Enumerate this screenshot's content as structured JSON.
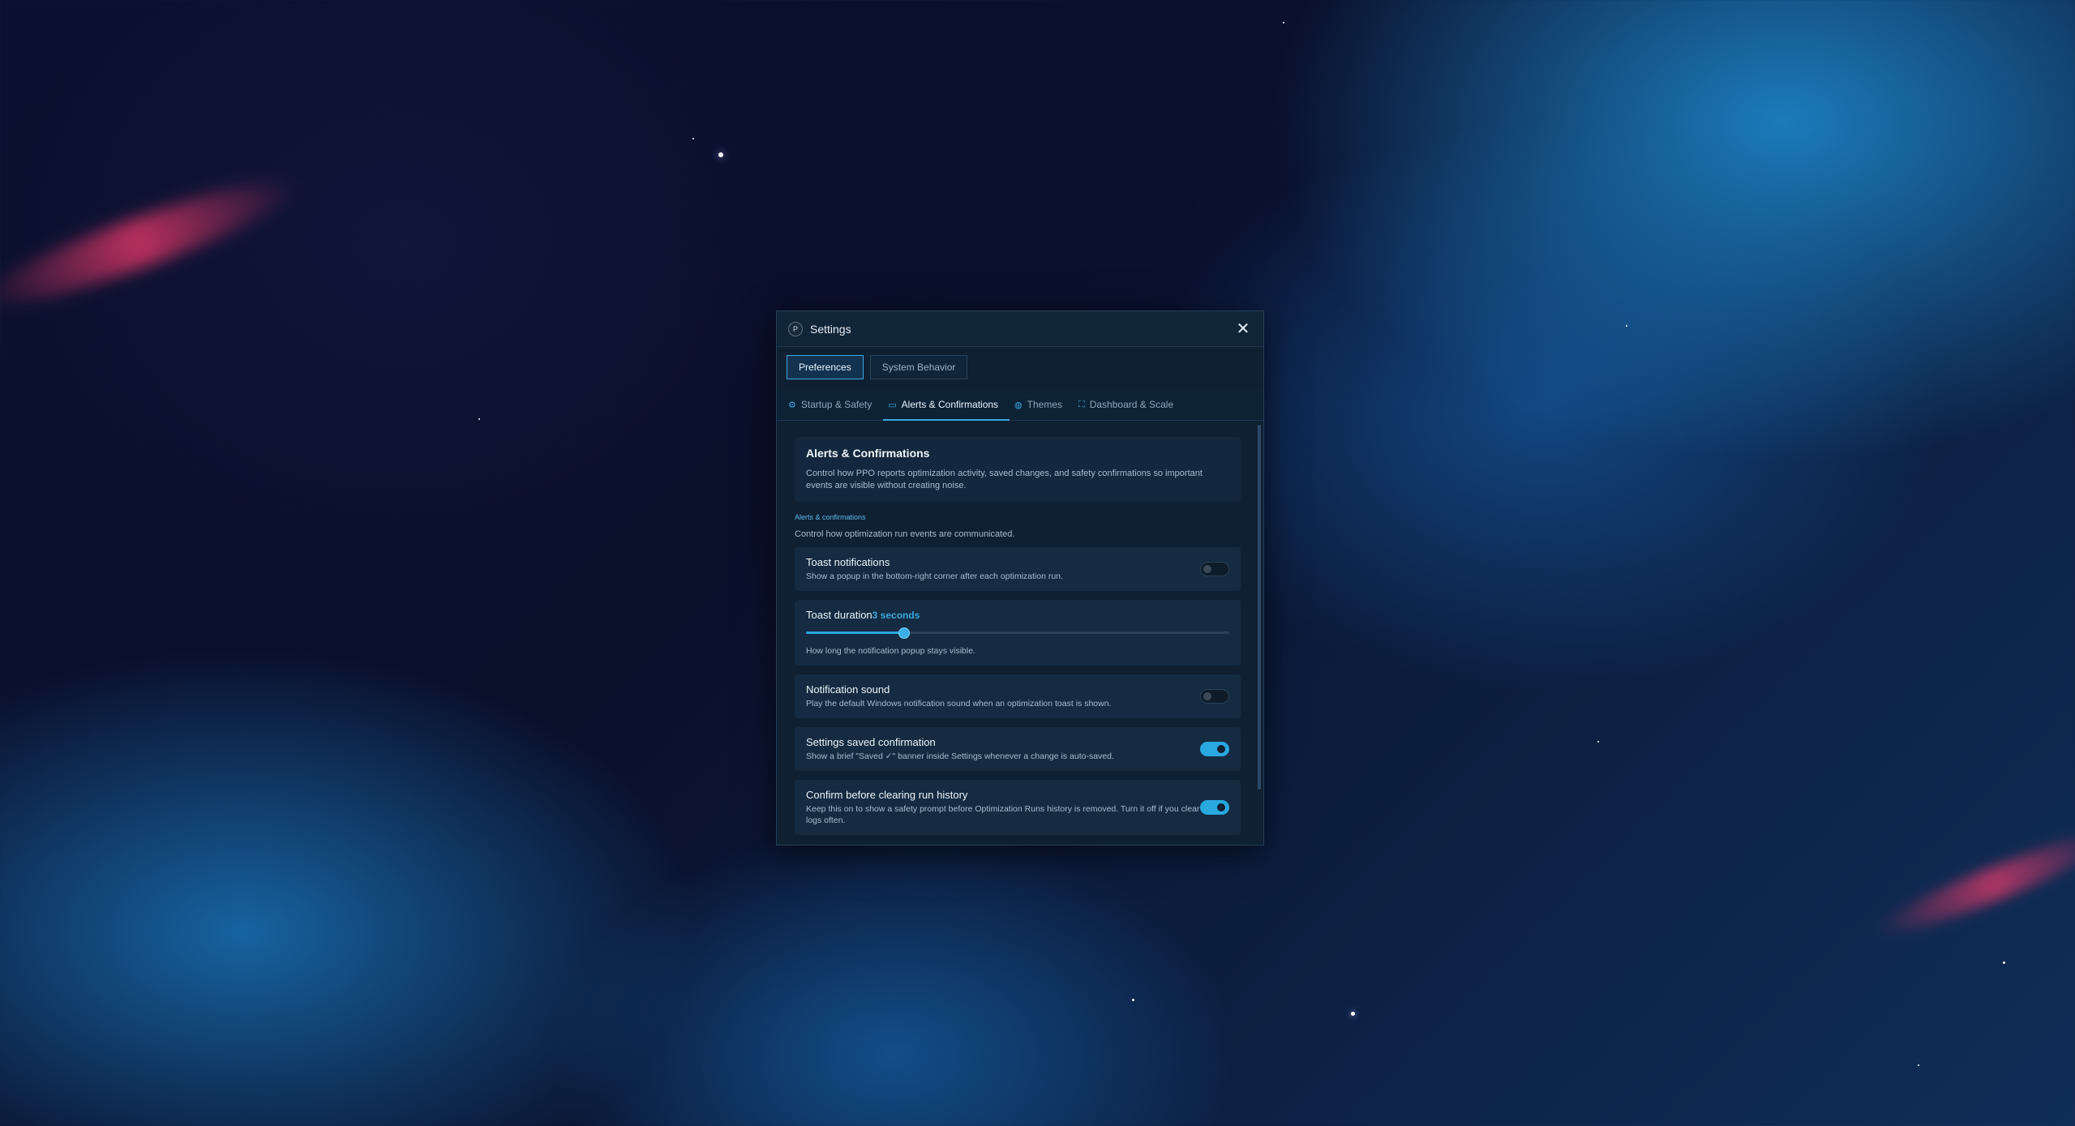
{
  "window": {
    "logo_letter": "P",
    "title": "Settings",
    "close_glyph": "✕"
  },
  "top_tabs": [
    {
      "label": "Preferences",
      "active": true
    },
    {
      "label": "System Behavior",
      "active": false
    }
  ],
  "sub_tabs": [
    {
      "label": "Startup & Safety",
      "icon": "gear-icon",
      "active": false
    },
    {
      "label": "Alerts & Confirmations",
      "icon": "monitor-icon",
      "active": true
    },
    {
      "label": "Themes",
      "icon": "palette-icon",
      "active": false
    },
    {
      "label": "Dashboard & Scale",
      "icon": "scale-icon",
      "active": false
    }
  ],
  "hero": {
    "title": "Alerts & Confirmations",
    "description": "Control how PPO reports optimization activity, saved changes, and safety confirmations so important events are visible without creating noise."
  },
  "section": {
    "label": "Alerts & confirmations",
    "description": "Control how optimization run events are communicated."
  },
  "settings": {
    "toast_notifications": {
      "title": "Toast notifications",
      "description": "Show a popup in the bottom-right corner after each optimization run.",
      "enabled": false
    },
    "toast_duration": {
      "title": "Toast duration",
      "value_text": "3 seconds",
      "slider_fraction": 0.23,
      "description": "How long the notification popup stays visible."
    },
    "notification_sound": {
      "title": "Notification sound",
      "description": "Play the default Windows notification sound when an optimization toast is shown.",
      "enabled": false
    },
    "settings_saved_confirmation": {
      "title": "Settings saved confirmation",
      "description": "Show a brief \"Saved ✓\" banner inside Settings whenever a change is auto-saved.",
      "enabled": true
    },
    "confirm_clear_history": {
      "title": "Confirm before clearing run history",
      "description": "Keep this on to show a safety prompt before Optimization Runs history is removed. Turn it off if you clear logs often.",
      "enabled": true
    }
  },
  "colors": {
    "accent": "#2aa8e0",
    "window_bg": "#0f2032",
    "card_bg": "#142b42"
  }
}
